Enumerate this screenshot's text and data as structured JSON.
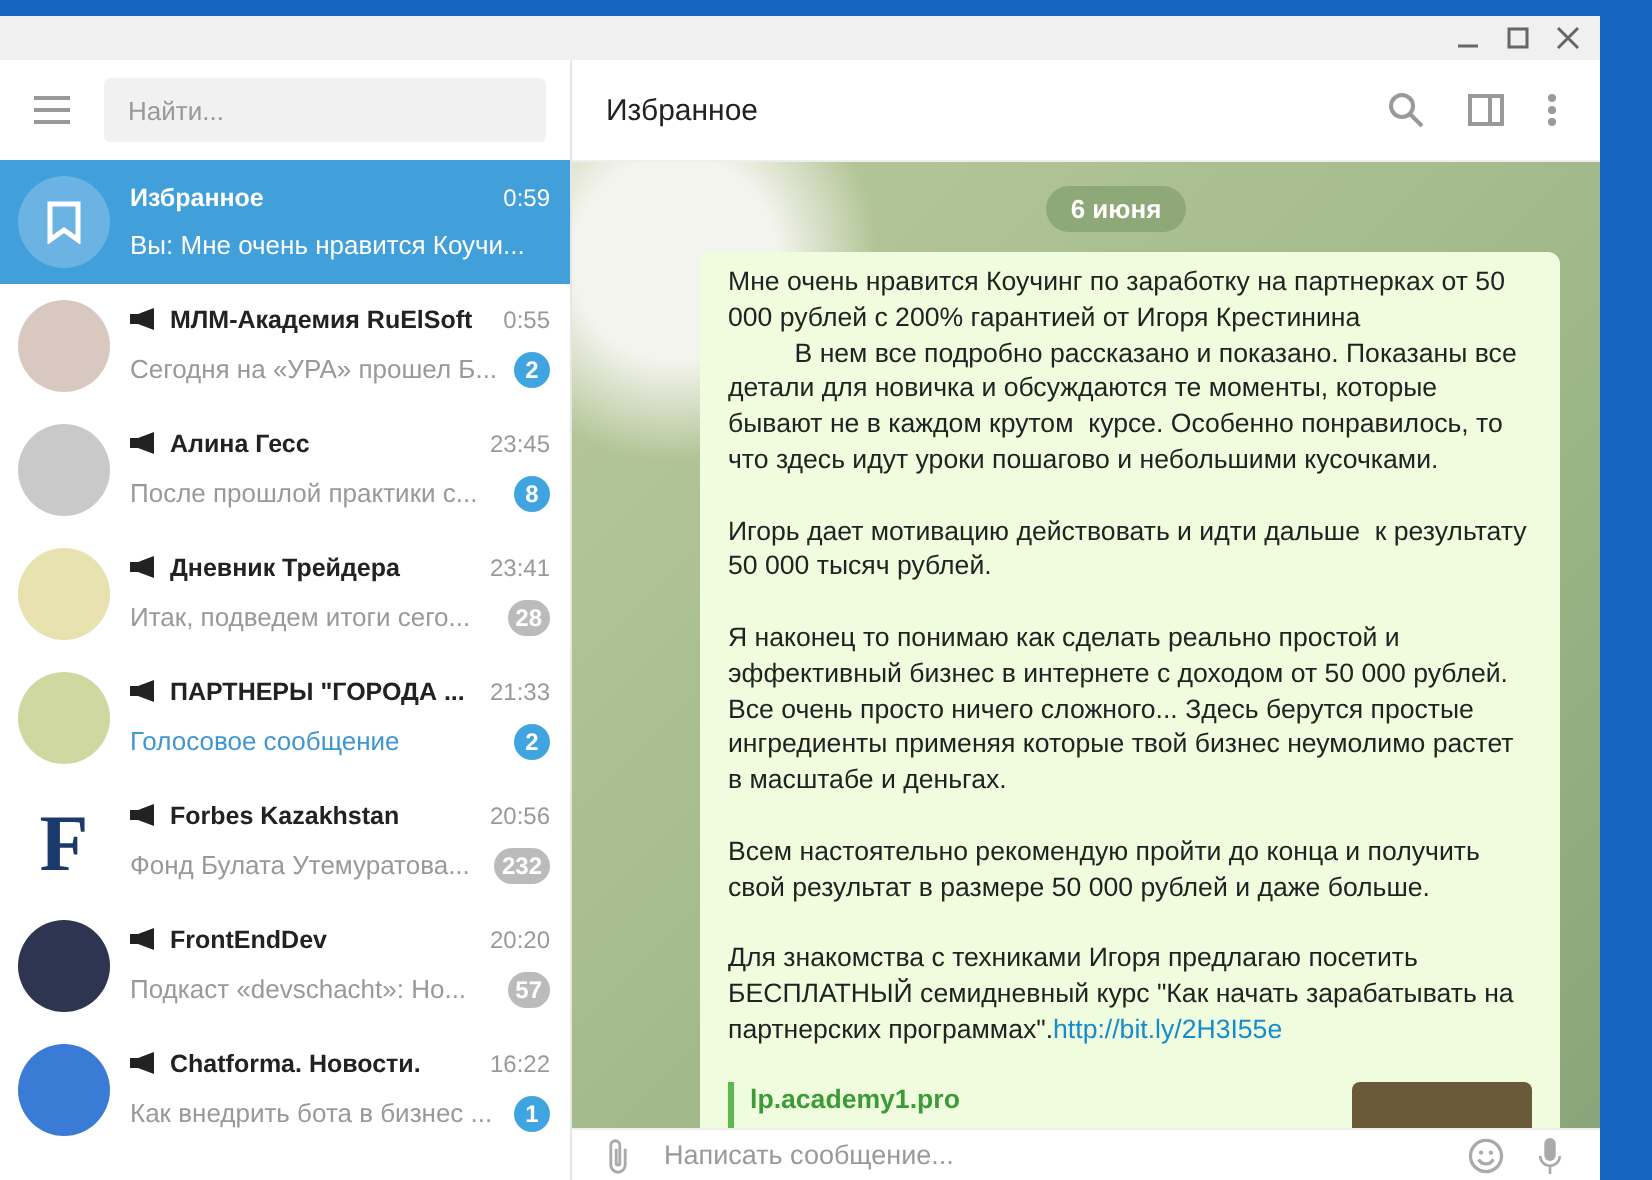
{
  "search": {
    "placeholder": "Найти..."
  },
  "chats": [
    {
      "name": "Избранное",
      "time": "0:59",
      "preview": {
        "text": "Вы: Мне очень нравится Коучи...",
        "kind": "text"
      },
      "avatar": {
        "kind": "saved"
      },
      "channel": false,
      "selected": true
    },
    {
      "name": "МЛМ-Академия RuElSoft",
      "time": "0:55",
      "preview": {
        "text": "Сегодня на «УРА» прошел Б...",
        "kind": "text"
      },
      "avatar": {
        "kind": "photo"
      },
      "channel": true,
      "unread": "2",
      "muted": false,
      "selected": false
    },
    {
      "name": "Алина Гесс",
      "time": "23:45",
      "preview": {
        "text": "После прошлой практики с...",
        "kind": "text"
      },
      "avatar": {
        "kind": "photo"
      },
      "channel": true,
      "unread": "8",
      "muted": false,
      "selected": false
    },
    {
      "name": "Дневник Трейдера",
      "time": "23:41",
      "preview": {
        "text": "Итак, подведем итоги сего...",
        "kind": "text"
      },
      "avatar": {
        "kind": "photo"
      },
      "channel": true,
      "unread": "28",
      "muted": true,
      "selected": false
    },
    {
      "name": "ПАРТНЕРЫ \"ГОРОДА ...",
      "time": "21:33",
      "preview": {
        "text": "Голосовое сообщение",
        "kind": "media"
      },
      "avatar": {
        "kind": "photo"
      },
      "channel": true,
      "unread": "2",
      "muted": false,
      "selected": false
    },
    {
      "name": "Forbes Kazakhstan",
      "time": "20:56",
      "preview": {
        "text": "Фонд Булата Утемуратова...",
        "kind": "text"
      },
      "avatar": {
        "kind": "letter",
        "text": "F"
      },
      "channel": true,
      "unread": "232",
      "muted": true,
      "selected": false
    },
    {
      "name": "FrontEndDev",
      "time": "20:20",
      "preview": {
        "text": "Подкаст «devschacht»:  Но...",
        "kind": "text"
      },
      "avatar": {
        "kind": "photo"
      },
      "channel": true,
      "unread": "57",
      "muted": true,
      "selected": false
    },
    {
      "name": "Chatforma. Новости.",
      "time": "16:22",
      "preview": {
        "text": "Как внедрить бота в бизнес ...",
        "kind": "text"
      },
      "avatar": {
        "kind": "photo"
      },
      "channel": true,
      "unread": "1",
      "muted": false,
      "selected": false
    }
  ],
  "chat_header": {
    "title": "Избранное"
  },
  "date_pill": "6 июня",
  "message": {
    "paragraphs": [
      "Мне очень нравится Коучинг по заработку на партнерках от 50 000 рублей с 200% гарантией от Игоря Крестинина\n         В нем все подробно рассказано и показано. Показаны все детали для новичка и обсуждаются те моменты, которые бывают не в каждом крутом  курсе. Особенно понравилось, то что здесь идут уроки пошагово и небольшими кусочками.",
      "Игорь дает мотивацию действовать и идти дальше  к результату 50 000 тысяч рублей.",
      "Я наконец то понимаю как сделать реально простой и эффективный бизнес в интернете с доходом от 50 000 рублей. Все очень просто ничего сложного... Здесь берутся простые ингредиенты применяя которые твой бизнес неумолимо растет в масштабе и деньгах.",
      "Всем настоятельно рекомендую пройти до конца и получить свой результат в размере 50 000 рублей и даже больше.",
      "Для знакомства с техниками Игоря предлагаю посетить БЕСПЛАТНЫЙ семидневный курс \"Как начать зарабатывать на партнерских программах\"."
    ],
    "link": "http://bit.ly/2H3I55e",
    "preview_site": "lp.academy1.pro"
  },
  "composer": {
    "placeholder": "Написать сообщение..."
  }
}
